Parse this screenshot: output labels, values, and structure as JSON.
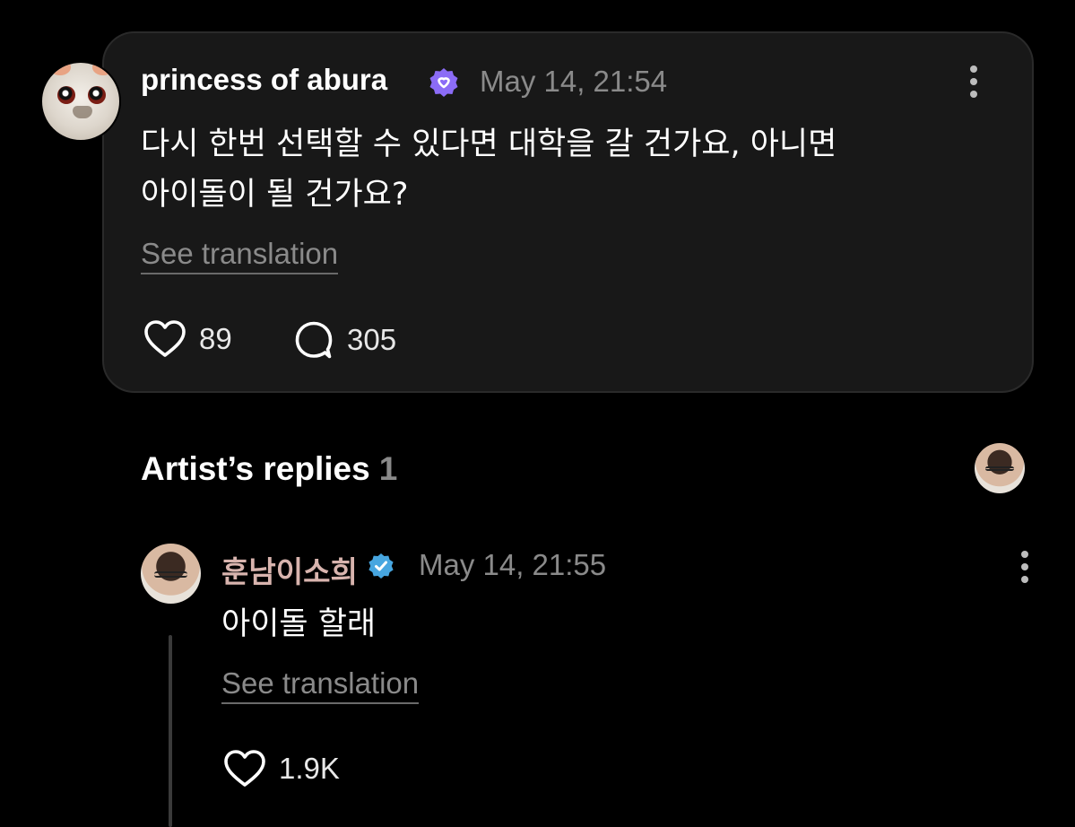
{
  "post": {
    "username": "princess of abura",
    "verified_icon": "verified-badge-purple",
    "timestamp": "May 14, 21:54",
    "text_line1": "다시 한번 선택할 수 있다면 대학을 갈 건가요, 아니면",
    "text_line2": "아이돌이 될 건가요?",
    "see_translation": "See translation",
    "likes": "89",
    "comments": "305",
    "colors": {
      "badge": "#8b6cf6",
      "card_bg": "#181818"
    }
  },
  "replies_section": {
    "title": "Artist’s replies",
    "count": "1"
  },
  "reply": {
    "username": "훈남이소희",
    "verified_icon": "verified-badge-blue",
    "timestamp": "May 14, 21:55",
    "text": "아이돌 할래",
    "see_translation": "See translation",
    "likes": "1.9K",
    "colors": {
      "username": "#d8b4ae",
      "badge": "#47a6e0"
    }
  }
}
